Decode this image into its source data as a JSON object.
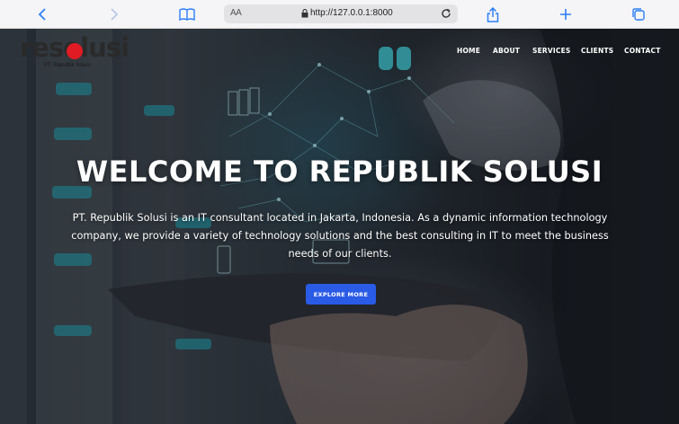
{
  "browser": {
    "text_size_label": "AA",
    "url": "http://127.0.0.1:8000"
  },
  "site": {
    "logo_text": "resolusi",
    "logo_subtitle": "PT. Republik Solusi",
    "nav": [
      {
        "label": "HOME"
      },
      {
        "label": "ABOUT"
      },
      {
        "label": "SERVICES"
      },
      {
        "label": "CLIENTS"
      },
      {
        "label": "CONTACT"
      }
    ]
  },
  "hero": {
    "title": "WELCOME TO REPUBLIK SOLUSI",
    "description": "PT. Republik Solusi is an IT consultant located in Jakarta, Indonesia. As a dynamic information technology company, we provide a variety of technology solutions and the best consulting in IT to meet the business needs of our clients.",
    "cta_label": "EXPLORE MORE",
    "cta_color": "#2a5be6"
  },
  "icons": [
    "back-icon",
    "forward-icon",
    "bookmarks-icon",
    "lock-icon",
    "reload-icon",
    "share-icon",
    "new-tab-icon",
    "tabs-icon"
  ]
}
